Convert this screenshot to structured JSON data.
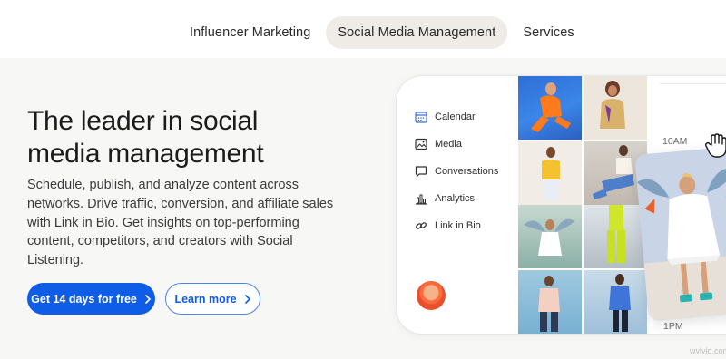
{
  "nav": {
    "items": [
      {
        "label": "Influencer Marketing",
        "active": false
      },
      {
        "label": "Social Media Management",
        "active": true
      },
      {
        "label": "Services",
        "active": false
      }
    ]
  },
  "hero": {
    "headline": "The leader in social media management",
    "subcopy": "Schedule, publish, and analyze content across networks. Drive traffic, conversion, and affiliate sales with Link in Bio. Get insights on top-performing content, competitors, and creators with Social Listening.",
    "primary_button": "Get 14 days for free",
    "secondary_button": "Learn more"
  },
  "mockup": {
    "menu": [
      {
        "label": "Calendar",
        "icon": "calendar-icon"
      },
      {
        "label": "Media",
        "icon": "image-icon"
      },
      {
        "label": "Conversations",
        "icon": "chat-bubble-icon"
      },
      {
        "label": "Analytics",
        "icon": "bar-chart-icon"
      },
      {
        "label": "Link in Bio",
        "icon": "link-icon"
      }
    ],
    "times": [
      "10AM",
      "1PM"
    ]
  },
  "watermark": "wvlvid.com",
  "colors": {
    "accent": "#0f5ce6",
    "nav_active_bg": "#efebe6",
    "hero_bg": "#f7f7f6"
  }
}
